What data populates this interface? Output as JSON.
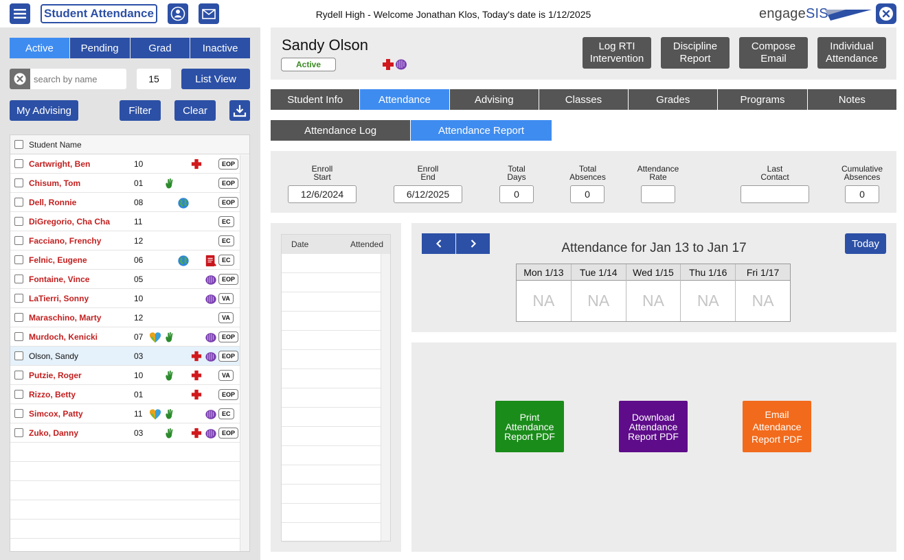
{
  "topbar": {
    "app_title": "Student Attendance",
    "welcome": "Rydell High - Welcome Jonathan Klos, Today's date is 1/12/2025",
    "logo_a": "engage",
    "logo_b": "SIS",
    "icons": [
      "menu-icon",
      "user-icon",
      "mail-icon",
      "close-icon"
    ]
  },
  "sidebar": {
    "status_tabs": [
      "Active",
      "Pending",
      "Grad",
      "Inactive"
    ],
    "active_tab": "Active",
    "search_placeholder": "search by name",
    "count": "15",
    "list_view_label": "List View",
    "my_advising_label": "My Advising",
    "filter_label": "Filter",
    "clear_label": "Clear",
    "column_header": "Student Name",
    "students": [
      {
        "name": "Cartwright, Ben",
        "grade": "10",
        "icons": [
          "medical"
        ],
        "badge": "EOP"
      },
      {
        "name": "Chisum, Tom",
        "grade": "01",
        "icons": [
          "hand"
        ],
        "badge": "EOP"
      },
      {
        "name": "Dell, Ronnie",
        "grade": "08",
        "icons": [
          "globe"
        ],
        "badge": "EOP"
      },
      {
        "name": "DiGregorio, Cha Cha",
        "grade": "11",
        "icons": [],
        "badge": "EC"
      },
      {
        "name": "Facciano, Frenchy",
        "grade": "12",
        "icons": [],
        "badge": "EC"
      },
      {
        "name": "Felnic, Eugene",
        "grade": "06",
        "icons": [
          "globe",
          "document"
        ],
        "badge": "EC"
      },
      {
        "name": "Fontaine, Vince",
        "grade": "05",
        "icons": [
          "hands"
        ],
        "badge": "EOP"
      },
      {
        "name": "LaTierri, Sonny",
        "grade": "10",
        "icons": [
          "hands"
        ],
        "badge": "VA"
      },
      {
        "name": "Maraschino, Marty",
        "grade": "12",
        "icons": [],
        "badge": "VA"
      },
      {
        "name": "Murdoch, Kenicki",
        "grade": "07",
        "icons": [
          "heart",
          "hand",
          "hands"
        ],
        "badge": "EOP"
      },
      {
        "name": "Olson, Sandy",
        "grade": "03",
        "icons": [
          "medical",
          "hands"
        ],
        "badge": "EOP",
        "selected": true
      },
      {
        "name": "Putzie, Roger",
        "grade": "10",
        "icons": [
          "hand",
          "medical"
        ],
        "badge": "VA"
      },
      {
        "name": "Rizzo, Betty",
        "grade": "01",
        "icons": [
          "medical"
        ],
        "badge": "EOP"
      },
      {
        "name": "Simcox, Patty",
        "grade": "11",
        "icons": [
          "heart",
          "hand",
          "hands"
        ],
        "badge": "EC"
      },
      {
        "name": "Zuko, Danny",
        "grade": "03",
        "icons": [
          "hand",
          "medical",
          "hands"
        ],
        "badge": "EOP"
      }
    ]
  },
  "student": {
    "name": "Sandy Olson",
    "status": "Active",
    "actions": [
      "Log RTI Intervention",
      "Discipline Report",
      "Compose Email",
      "Individual Attendance"
    ]
  },
  "tabs": [
    "Student Info",
    "Attendance",
    "Advising",
    "Classes",
    "Grades",
    "Programs",
    "Notes"
  ],
  "active_tab": "Attendance",
  "subtabs": [
    "Attendance Log",
    "Attendance Report"
  ],
  "active_subtab": "Attendance Report",
  "stats": [
    {
      "label1": "Enroll",
      "label2": "Start",
      "value": "12/6/2024"
    },
    {
      "label1": "Enroll",
      "label2": "End",
      "value": "6/12/2025"
    },
    {
      "label1": "Total",
      "label2": "Days",
      "value": "0"
    },
    {
      "label1": "Total",
      "label2": "Absences",
      "value": "0"
    },
    {
      "label1": "Attendance",
      "label2": "Rate",
      "value": ""
    },
    {
      "label1": "Last",
      "label2": "Contact",
      "value": ""
    },
    {
      "label1": "Cumulative",
      "label2": "Absences",
      "value": "0"
    }
  ],
  "log": {
    "col_date": "Date",
    "col_attended": "Attended"
  },
  "week": {
    "title": "Attendance for Jan 13 to Jan 17",
    "today_label": "Today",
    "days": [
      {
        "label": "Mon 1/13",
        "value": "NA"
      },
      {
        "label": "Tue 1/14",
        "value": "NA"
      },
      {
        "label": "Wed 1/15",
        "value": "NA"
      },
      {
        "label": "Thu 1/16",
        "value": "NA"
      },
      {
        "label": "Fri 1/17",
        "value": "NA"
      }
    ]
  },
  "report_actions": [
    {
      "line1": "Print",
      "line2": "Attendance",
      "line3": "Report PDF",
      "color": "#1a8c1a"
    },
    {
      "line1": "Download",
      "line2": "Attendance",
      "line3": "Report PDF",
      "color": "#5e0c8a"
    },
    {
      "line1": "Email",
      "line2": "Attendance",
      "line3": "Report PDF",
      "color": "#f26a1b"
    }
  ],
  "colors": {
    "primary": "#2c50a6",
    "active": "#3f8cf0",
    "grey_btn": "#555555",
    "name_red": "#c21f1f"
  }
}
